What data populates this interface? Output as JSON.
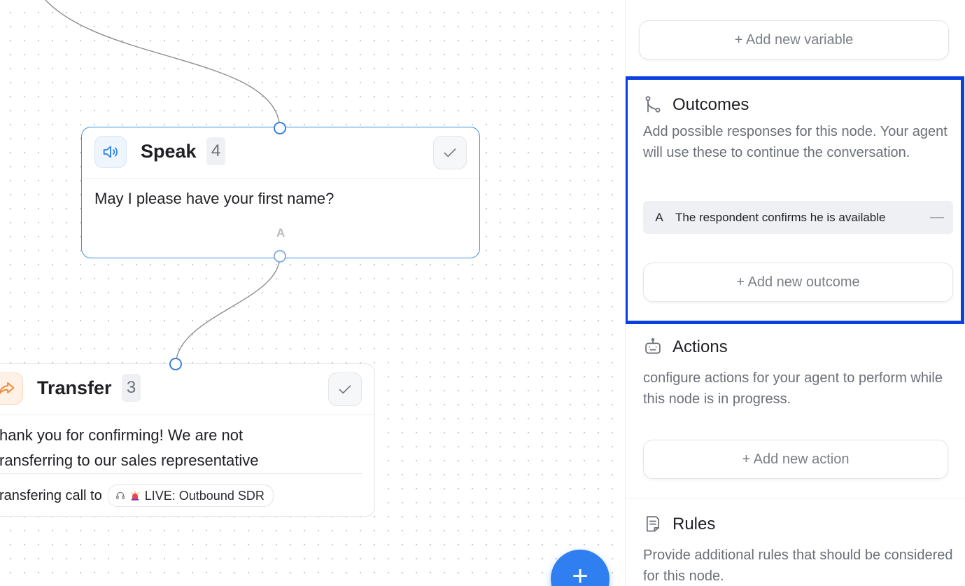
{
  "canvas": {
    "speak_node": {
      "title": "Speak",
      "count": "4",
      "text": "May I please have your first name?",
      "handle_label": "A"
    },
    "transfer_node": {
      "title": "Transfer",
      "count": "3",
      "text_line1": "hank you for confirming! We are not",
      "text_line2": "ransferring to our sales representative",
      "footer_label": "ransfering call to",
      "target_chip": "LIVE: Outbound SDR"
    },
    "fab_label": "+"
  },
  "panel": {
    "add_variable_label": "+ Add new variable",
    "outcomes": {
      "title": "Outcomes",
      "description": "Add possible responses for this node. Your agent will use these to continue the conversation.",
      "items": [
        {
          "letter": "A",
          "text": "The respondent confirms he is available",
          "remove": "—"
        }
      ],
      "add_label": "+ Add new outcome"
    },
    "actions": {
      "title": "Actions",
      "description": "configure actions for your agent to perform while this node is in progress.",
      "add_label": "+ Add new action"
    },
    "rules": {
      "title": "Rules",
      "description": "Provide additional rules that should be considered for this node."
    }
  },
  "colors": {
    "accent": "#2f7ff0",
    "highlight": "#0a3fe0",
    "transfer_accent": "#f08a3c"
  },
  "icons": {
    "speak": "speaker-icon",
    "transfer": "forward-arrow-icon",
    "check": "check-icon",
    "outcomes": "branch-icon",
    "actions": "robot-icon",
    "rules": "document-icon",
    "chip_headset": "headset-icon",
    "chip_siren": "siren-icon"
  }
}
